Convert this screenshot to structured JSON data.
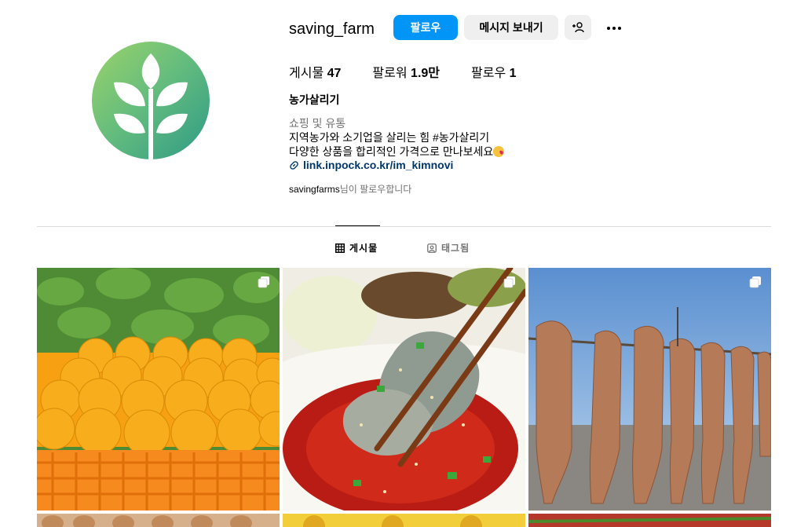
{
  "profile": {
    "username": "saving_farm",
    "follow_label": "팔로우",
    "message_label": "메시지 보내기",
    "stats": {
      "posts_label": "게시물",
      "posts_value": "47",
      "followers_label": "팔로워",
      "followers_value": "1.9만",
      "following_label": "팔로우",
      "following_value": "1"
    },
    "full_name": "농가살리기",
    "category": "쇼핑 및 유통",
    "bio_line1": "지역농가와 소기업을 살리는 힘 #농가살리기",
    "bio_line2": "다양한 상품을 합리적인 가격으로 만나보세요",
    "link": "link.inpock.co.kr/im_kimnovi",
    "followed_by_user": "savingfarms",
    "followed_by_suffix": "님이 팔로우합니다"
  },
  "tabs": {
    "posts": "게시물",
    "tagged": "태그됨"
  },
  "colors": {
    "accent": "#0095f6",
    "link": "#00376b",
    "secondary_text": "#737373",
    "button_bg": "#efefef"
  },
  "icons": [
    "leaf-logo-icon",
    "add-person-icon",
    "more-icon",
    "link-icon",
    "grid-icon",
    "tagged-icon",
    "multi-post-icon"
  ]
}
